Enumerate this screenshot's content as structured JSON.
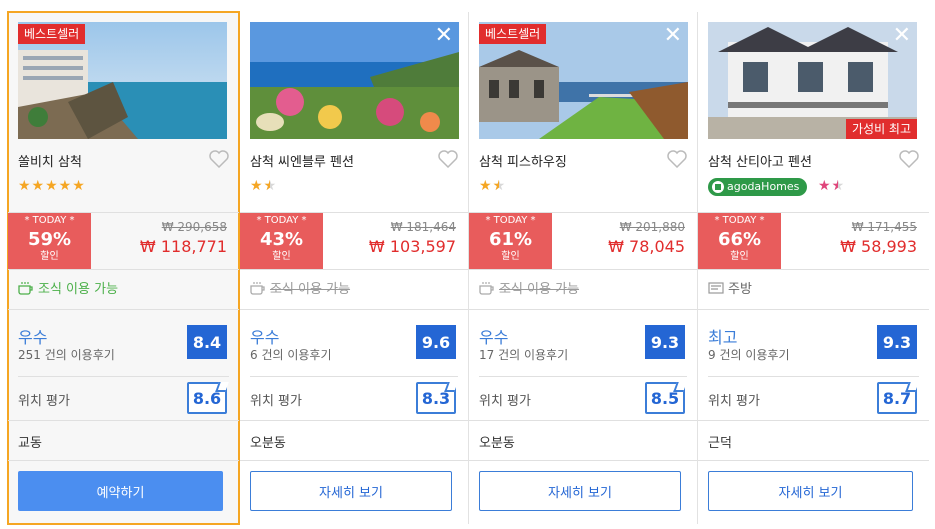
{
  "cards": [
    {
      "badge": "베스트셀러",
      "name": "쏠비치 삼척",
      "stars": 5,
      "today_label": "* TODAY *",
      "discount": "59%",
      "discount_label": "할인",
      "price_old": "₩ 290,658",
      "price_new": "₩ 118,771",
      "amenity": "조식 이용 가능",
      "rating_word": "우수",
      "reviews": "251 건의 이용후기",
      "score": "8.4",
      "loc_label": "위치 평가",
      "loc_score": "8.6",
      "area": "교동",
      "button": "예약하기"
    },
    {
      "name": "삼척 씨엔블루 펜션",
      "stars": 1.5,
      "today_label": "* TODAY *",
      "discount": "43%",
      "discount_label": "할인",
      "price_old": "₩ 181,464",
      "price_new": "₩ 103,597",
      "amenity": "조식 이용 가능",
      "rating_word": "우수",
      "reviews": "6 건의 이용후기",
      "score": "9.6",
      "loc_label": "위치 평가",
      "loc_score": "8.3",
      "area": "오분동",
      "button": "자세히 보기"
    },
    {
      "badge": "베스트셀러",
      "name": "삼척 피스하우징",
      "stars": 1.5,
      "today_label": "* TODAY *",
      "discount": "61%",
      "discount_label": "할인",
      "price_old": "₩ 201,880",
      "price_new": "₩ 78,045",
      "amenity": "조식 이용 가능",
      "rating_word": "우수",
      "reviews": "17 건의 이용후기",
      "score": "9.3",
      "loc_label": "위치 평가",
      "loc_score": "8.5",
      "area": "오분동",
      "button": "자세히 보기"
    },
    {
      "badge_value": "가성비 최고",
      "name": "삼척 산티아고 펜션",
      "agoda_label": "agodaHomes",
      "stars": 1.5,
      "today_label": "* TODAY *",
      "discount": "66%",
      "discount_label": "할인",
      "price_old": "₩ 171,455",
      "price_new": "₩ 58,993",
      "amenity": "주방",
      "rating_word": "최고",
      "reviews": "9 건의 이용후기",
      "score": "9.3",
      "loc_label": "위치 평가",
      "loc_score": "8.7",
      "area": "근덕",
      "button": "자세히 보기"
    }
  ],
  "colors": {
    "accent_blue": "#2466d4",
    "sale_red": "#e85c5c",
    "selected_border": "#f5a623",
    "amenity_green": "#4cb04a"
  }
}
